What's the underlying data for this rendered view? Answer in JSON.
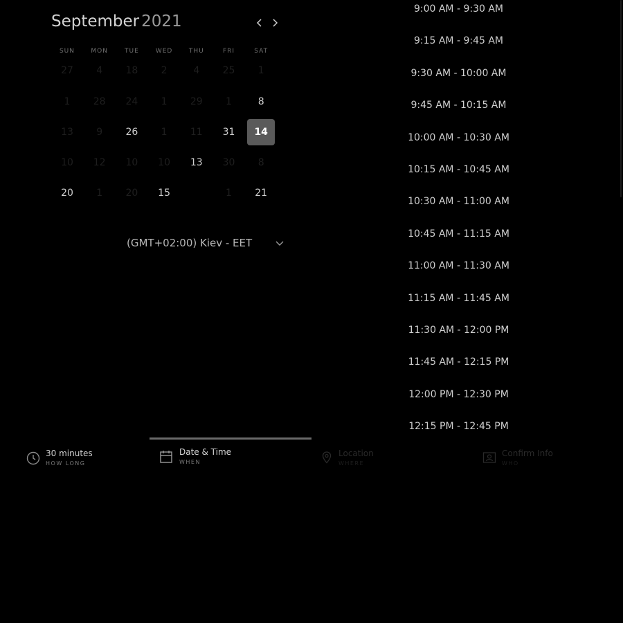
{
  "calendar": {
    "month": "September",
    "year": "2021",
    "prev_icon": "chevron-left-icon",
    "next_icon": "chevron-right-icon",
    "weekdays": [
      "SUN",
      "MON",
      "TUE",
      "WED",
      "THU",
      "FRI",
      "SAT"
    ],
    "weeks": [
      [
        {
          "label": "27",
          "available": false
        },
        {
          "label": "4",
          "available": false
        },
        {
          "label": "18",
          "available": false
        },
        {
          "label": "2",
          "available": false
        },
        {
          "label": "4",
          "available": false
        },
        {
          "label": "25",
          "available": false
        },
        {
          "label": "1",
          "available": false
        }
      ],
      [
        {
          "label": "1",
          "available": false
        },
        {
          "label": "28",
          "available": false
        },
        {
          "label": "24",
          "available": false
        },
        {
          "label": "1",
          "available": false
        },
        {
          "label": "29",
          "available": false
        },
        {
          "label": "1",
          "available": false
        },
        {
          "label": "8",
          "available": true
        }
      ],
      [
        {
          "label": "13",
          "available": false
        },
        {
          "label": "9",
          "available": false
        },
        {
          "label": "26",
          "available": true
        },
        {
          "label": "1",
          "available": false
        },
        {
          "label": "11",
          "available": false
        },
        {
          "label": "31",
          "available": true
        },
        {
          "label": "14",
          "available": true,
          "selected": true
        }
      ],
      [
        {
          "label": "10",
          "available": false
        },
        {
          "label": "12",
          "available": false
        },
        {
          "label": "10",
          "available": false
        },
        {
          "label": "10",
          "available": false
        },
        {
          "label": "13",
          "available": true
        },
        {
          "label": "30",
          "available": false
        },
        {
          "label": "8",
          "available": false
        }
      ],
      [
        {
          "label": "20",
          "available": true
        },
        {
          "label": "1",
          "available": false
        },
        {
          "label": "20",
          "available": false
        },
        {
          "label": "15",
          "available": true
        },
        {
          "label": "",
          "available": false
        },
        {
          "label": "1",
          "available": false
        },
        {
          "label": "21",
          "available": true
        }
      ]
    ],
    "selected_date": "14",
    "timezone": "(GMT+02:00) Kiev - EET",
    "timezone_icon": "chevron-down-icon"
  },
  "slots": [
    "9:00 AM - 9:30 AM",
    "9:15 AM - 9:45 AM",
    "9:30 AM - 10:00 AM",
    "9:45 AM - 10:15 AM",
    "10:00 AM - 10:30 AM",
    "10:15 AM - 10:45 AM",
    "10:30 AM - 11:00 AM",
    "10:45 AM - 11:15 AM",
    "11:00 AM - 11:30 AM",
    "11:15 AM - 11:45 AM",
    "11:30 AM - 12:00 PM",
    "11:45 AM - 12:15 PM",
    "12:00 PM - 12:30 PM",
    "12:15 PM - 12:45 PM"
  ],
  "steps": [
    {
      "title": "30 minutes",
      "subtitle": "HOW LONG",
      "icon": "clock-icon",
      "state": "done"
    },
    {
      "title": "Date & Time",
      "subtitle": "WHEN",
      "icon": "calendar-icon",
      "state": "active"
    },
    {
      "title": "Location",
      "subtitle": "WHERE",
      "icon": "location-pin-icon",
      "state": "upcoming"
    },
    {
      "title": "Confirm Info",
      "subtitle": "WHO",
      "icon": "person-card-icon",
      "state": "upcoming"
    }
  ],
  "colors": {
    "background": "#000000",
    "text_primary": "#cfcfcf",
    "text_muted": "#6f6f6f",
    "text_disabled": "#1e1e1e",
    "selected_bg": "#5a5a5a",
    "active_step_underline": "#6a6a6a"
  }
}
